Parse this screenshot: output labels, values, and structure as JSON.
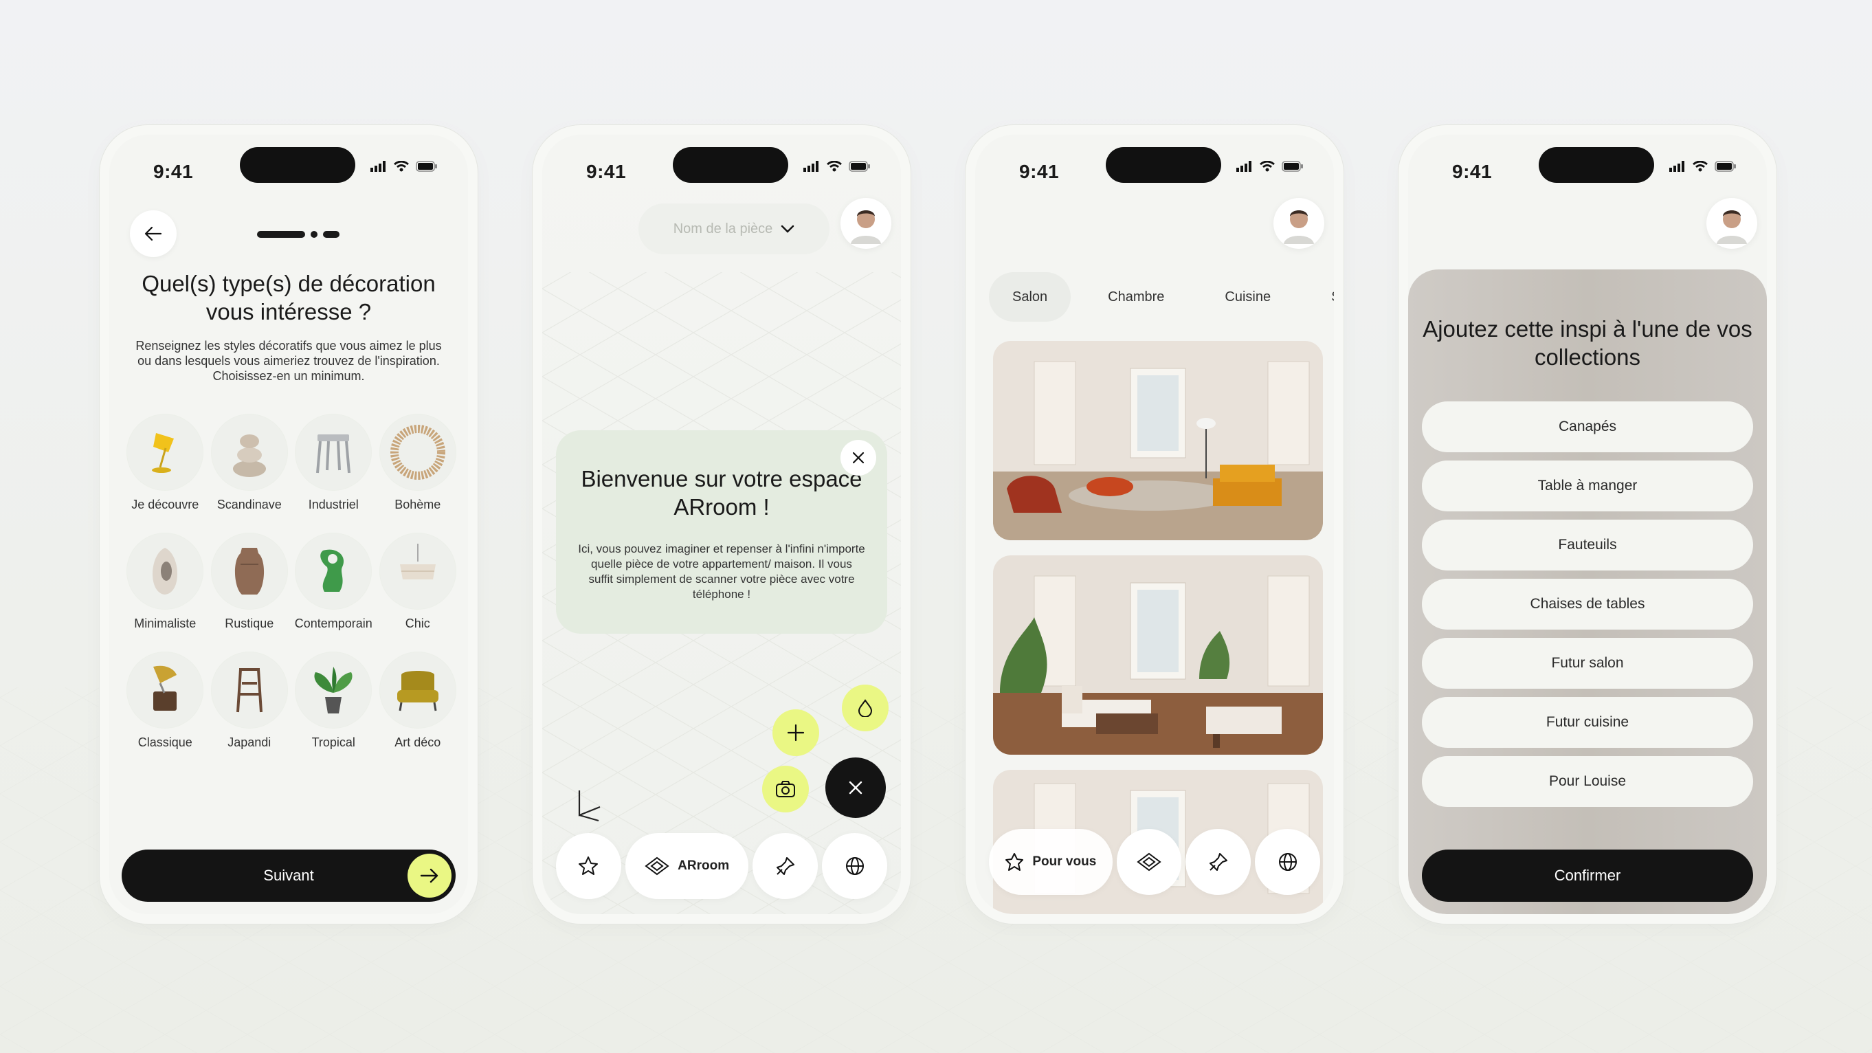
{
  "colors": {
    "accent": "#eaf784",
    "dark": "#141414",
    "welcome_bg": "#e4ece0"
  },
  "status": {
    "time": "9:41"
  },
  "screen1": {
    "title": "Quel(s) type(s) de décoration vous intéresse ?",
    "description": "Renseignez les styles décoratifs que vous aimez le plus ou dans lesquels vous aimeriez trouvez de l'inspiration. Choisissez-en un minimum.",
    "styles": [
      {
        "label": "Je découvre",
        "icon": "lamp-icon"
      },
      {
        "label": "Scandinave",
        "icon": "stacked-stones-icon"
      },
      {
        "label": "Industriel",
        "icon": "metal-stool-icon"
      },
      {
        "label": "Bohème",
        "icon": "rattan-mirror-icon"
      },
      {
        "label": "Minimaliste",
        "icon": "ring-vase-icon"
      },
      {
        "label": "Rustique",
        "icon": "clay-vase-icon"
      },
      {
        "label": "Contemporain",
        "icon": "green-sculpture-icon"
      },
      {
        "label": "Chic",
        "icon": "pendant-lamp-icon"
      },
      {
        "label": "Classique",
        "icon": "gramophone-icon"
      },
      {
        "label": "Japandi",
        "icon": "wood-chair-icon"
      },
      {
        "label": "Tropical",
        "icon": "potted-plant-icon"
      },
      {
        "label": "Art déco",
        "icon": "velvet-armchair-icon"
      }
    ],
    "next_label": "Suivant"
  },
  "screen2": {
    "room_placeholder": "Nom de la pièce",
    "welcome_title": "Bienvenue sur votre espace ARroom !",
    "welcome_text": "Ici, vous pouvez imaginer et repenser à l'infini n'importe quelle pièce de votre appartement/ maison. Il vous suffit simplement de scanner votre pièce avec votre téléphone !",
    "tab_active": "ARroom"
  },
  "screen3": {
    "rooms": [
      "Salon",
      "Chambre",
      "Cuisine",
      "Salle de bain"
    ],
    "tab_active": "Pour vous"
  },
  "screen4": {
    "title": "Ajoutez cette inspi à l'une de vos collections",
    "collections": [
      "Canapés",
      "Table à manger",
      "Fauteuils",
      "Chaises de tables",
      "Futur salon",
      "Futur cuisine",
      "Pour Louise"
    ],
    "confirm_label": "Confirmer"
  }
}
